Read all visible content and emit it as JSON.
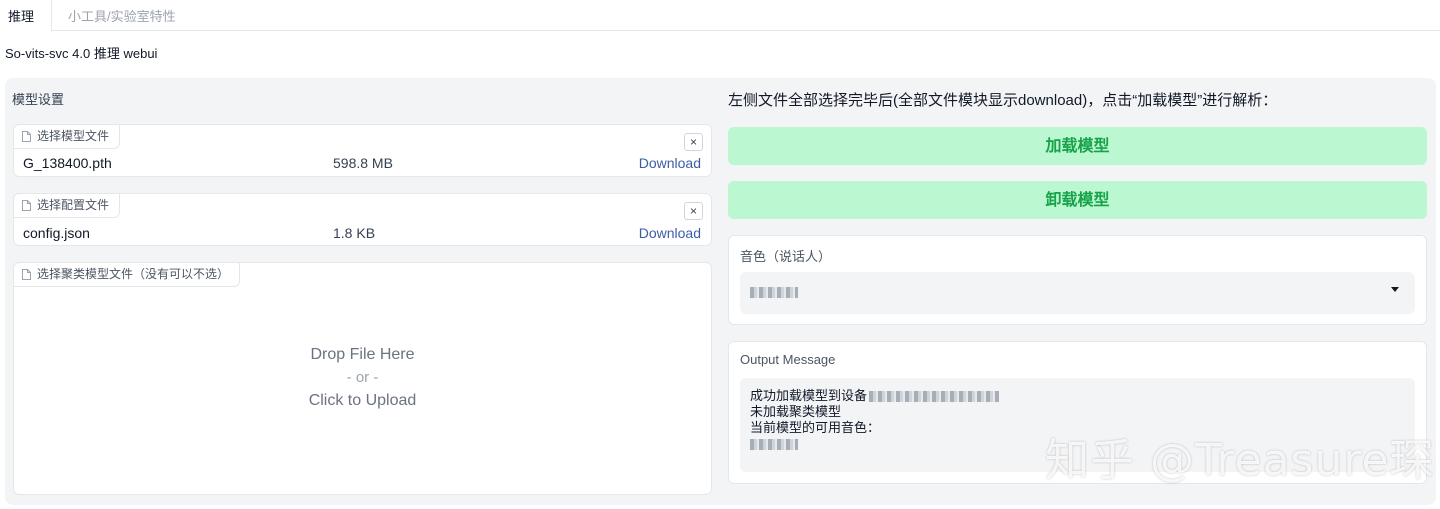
{
  "tabs": [
    {
      "label": "推理",
      "active": true
    },
    {
      "label": "小工具/实验室特性",
      "active": false
    }
  ],
  "page_title": "So-vits-svc 4.0 推理 webui",
  "left": {
    "section_label": "模型设置",
    "model_file": {
      "tag": "选择模型文件",
      "name": "G_138400.pth",
      "size": "598.8 MB",
      "link": "Download",
      "close": "×"
    },
    "config_file": {
      "tag": "选择配置文件",
      "name": "config.json",
      "size": "1.8 KB",
      "link": "Download",
      "close": "×"
    },
    "cluster_file": {
      "tag": "选择聚类模型文件（没有可以不选）",
      "drop_line1": "Drop File Here",
      "drop_or": "- or -",
      "drop_line2": "Click to Upload"
    }
  },
  "right": {
    "instruction": "左侧文件全部选择完毕后(全部文件模块显示download)，点击“加载模型”进行解析：",
    "load_button": "加载模型",
    "unload_button": "卸载模型",
    "speaker": {
      "label": "音色（说话人）"
    },
    "output": {
      "label": "Output Message",
      "line1": "成功加载模型到设备",
      "line2": "未加载聚类模型",
      "line3": "当前模型的可用音色："
    }
  },
  "watermark": "知乎 @Treasure琛",
  "colors": {
    "button_bg": "#bbf7d0",
    "button_text": "#16a34a",
    "link": "#3b5da8",
    "panel_bg": "#f3f4f6"
  },
  "icons": [
    "file-icon",
    "close-icon",
    "chevron-down-icon"
  ]
}
